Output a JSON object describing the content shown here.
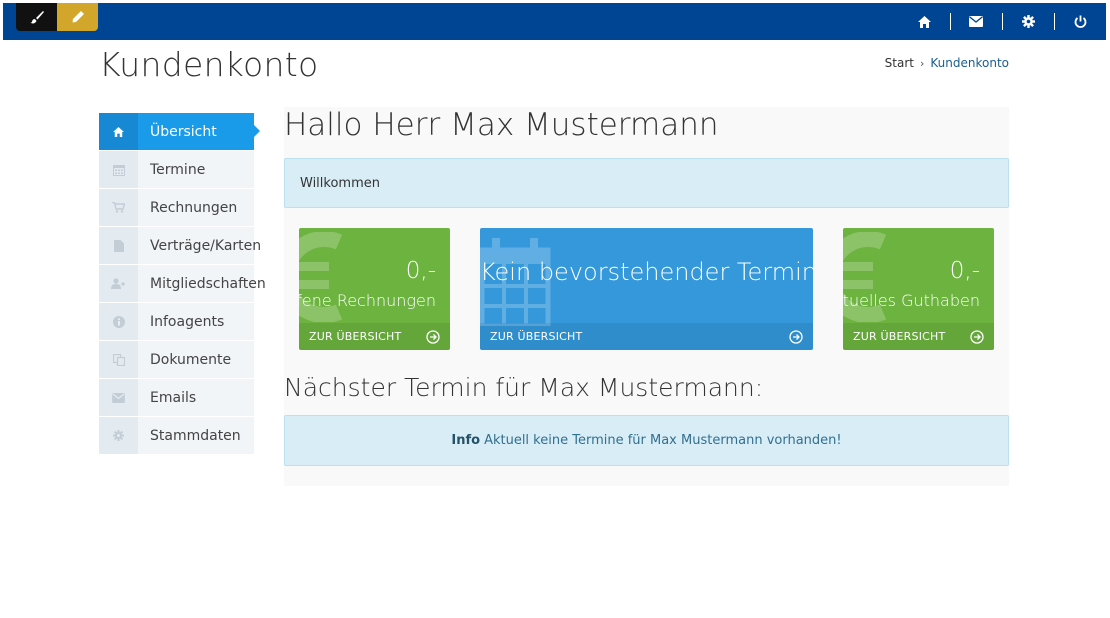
{
  "header": {
    "title": "Kundenkonto",
    "breadcrumb": {
      "home": "Start",
      "separator": "›",
      "current": "Kundenkonto"
    }
  },
  "topbar": {
    "left_icons": [
      "brush-icon",
      "pencil-icon"
    ],
    "right_icons": [
      "home-icon",
      "envelope-icon",
      "gear-icon",
      "power-icon"
    ],
    "colors": {
      "bar": "#004494",
      "brush": "#111111",
      "pencil": "#d1a62a"
    }
  },
  "sidebar": {
    "items": [
      {
        "label": "Übersicht",
        "icon": "home-icon",
        "active": true
      },
      {
        "label": "Termine",
        "icon": "calendar-icon"
      },
      {
        "label": "Rechnungen",
        "icon": "cart-icon"
      },
      {
        "label": "Verträge/Karten",
        "icon": "file-icon"
      },
      {
        "label": "Mitgliedschaften",
        "icon": "user-plus-icon"
      },
      {
        "label": "Infoagents",
        "icon": "info-icon"
      },
      {
        "label": "Dokumente",
        "icon": "copy-icon"
      },
      {
        "label": "Emails",
        "icon": "envelope-icon"
      },
      {
        "label": "Stammdaten",
        "icon": "gear-icon"
      }
    ]
  },
  "main": {
    "greeting": "Hallo Herr Max Mustermann",
    "welcome": "Willkommen",
    "tiles": [
      {
        "value": "0,-",
        "label": "Offene Rechnungen",
        "link": "ZUR ÜBERSICHT",
        "color": "#6cb33f"
      },
      {
        "value": "Kein bevorstehender Termin",
        "link": "ZUR ÜBERSICHT",
        "color": "#3498db"
      },
      {
        "value": "0,-",
        "label": "Aktuelles Guthaben",
        "link": "ZUR ÜBERSICHT",
        "color": "#6cb33f"
      }
    ],
    "next_title": "Nächster Termin für Max Mustermann:",
    "info": {
      "strong": "Info",
      "text": "Aktuell keine Termine für Max Mustermann vorhanden!"
    }
  }
}
